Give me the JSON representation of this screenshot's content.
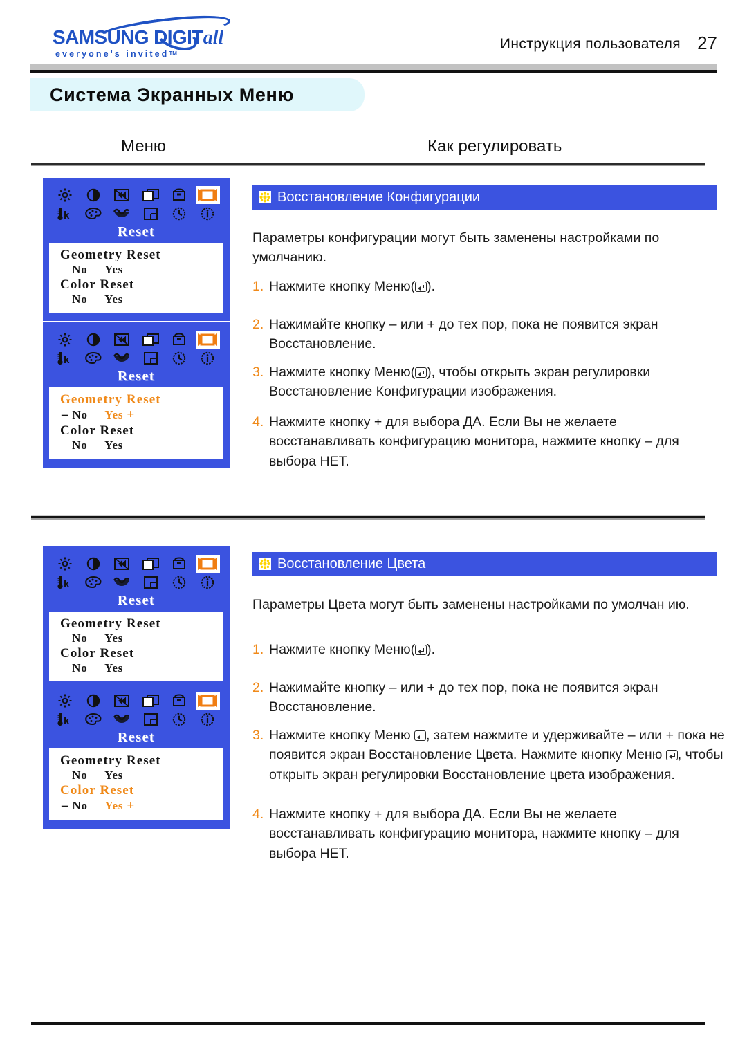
{
  "header": {
    "logo_wordmark": "SAMSUNG DIGIT",
    "logo_wordmark_italic": "all",
    "logo_tagline": "everyone's invited",
    "logo_tagline_tm": "TM",
    "manual_label": "Инструкция пользователя",
    "page_number": "27"
  },
  "page_title": "Система Экранных Меню",
  "columns": {
    "left": "Меню",
    "right": "Как регулировать"
  },
  "osd": {
    "title": "Reset",
    "icons": [
      "brightness-icon",
      "contrast-icon",
      "h-position-icon",
      "h-size-icon",
      "pincushion-icon",
      "reset-icon",
      "color-temp-icon",
      "color-control-icon",
      "rotation-icon",
      "v-position-icon",
      "clock-icon",
      "information-icon"
    ],
    "selected_icon": "reset-icon",
    "rows": {
      "geometry_label": "Geometry Reset",
      "color_label": "Color Reset",
      "no": "No",
      "yes": "Yes",
      "minus": "–",
      "plus": "+"
    },
    "panels": [
      {
        "name": "osd-reset-default",
        "highlight": "none"
      },
      {
        "name": "osd-geometry-reset-selected",
        "highlight": "geometry"
      },
      {
        "name": "osd-reset-default-2",
        "highlight": "none"
      },
      {
        "name": "osd-color-reset-selected",
        "highlight": "color"
      }
    ]
  },
  "sections": [
    {
      "heading": "Восстановление Конфигурации",
      "icon": "flower-bullet-icon",
      "intro": "Параметры конфигурации могут быть заменены настройками по умолчанию.",
      "steps": [
        {
          "num": "1.",
          "parts": [
            {
              "t": "Нажмите кнопку Меню("
            },
            {
              "key": true
            },
            {
              "t": ")."
            }
          ]
        },
        {
          "num": "2.",
          "parts": [
            {
              "t": "Нажимайте кнопку – или + до тех пор, пока не появится экран Восстановление."
            }
          ]
        },
        {
          "num": "3.",
          "parts": [
            {
              "t": "Нажмите кнопку Меню("
            },
            {
              "key": true
            },
            {
              "t": "), чтобы открыть экран регулировки Восстановление Конфигурации изображения."
            }
          ]
        },
        {
          "num": "4.",
          "parts": [
            {
              "t": "Нажмите кнопку + для выбора ДА. Если Вы не желаете восстанавливать конфигурацию монитора, нажмите кнопку – для выбора НЕТ."
            }
          ]
        }
      ]
    },
    {
      "heading": "Восстановление Цвета",
      "icon": "flower-bullet-icon",
      "intro": "Параметры Цвета могут быть заменены настройками по умолчан ию.",
      "steps": [
        {
          "num": "1.",
          "parts": [
            {
              "t": "Нажмите кнопку Меню("
            },
            {
              "key": true
            },
            {
              "t": ")."
            }
          ]
        },
        {
          "num": "2.",
          "parts": [
            {
              "t": "Нажимайте кнопку – или + до тех пор, пока не появится экран Восстановление."
            }
          ]
        },
        {
          "num": "3.",
          "parts": [
            {
              "t": "Нажмите кнопку Меню "
            },
            {
              "key": true
            },
            {
              "t": ", затем нажмите и удерживайте – или + пока не появится экран Восстановление Цвета. Нажмите кнопку Меню "
            },
            {
              "key": true
            },
            {
              "t": ", чтобы открыть экран регулировки Восстановление цвета изображения."
            }
          ]
        },
        {
          "num": "4.",
          "parts": [
            {
              "t": "Нажмите кнопку + для выбора ДА. Если Вы не желаете восстанавливать конфигурацию монитора, нажмите кнопку – для выбора НЕТ."
            }
          ]
        }
      ]
    }
  ],
  "colors": {
    "osd_blue": "#3b53e0",
    "accent_orange": "#f08a1a",
    "banner_cyan": "#e0f7fb",
    "logo_blue": "#1f52c4"
  }
}
